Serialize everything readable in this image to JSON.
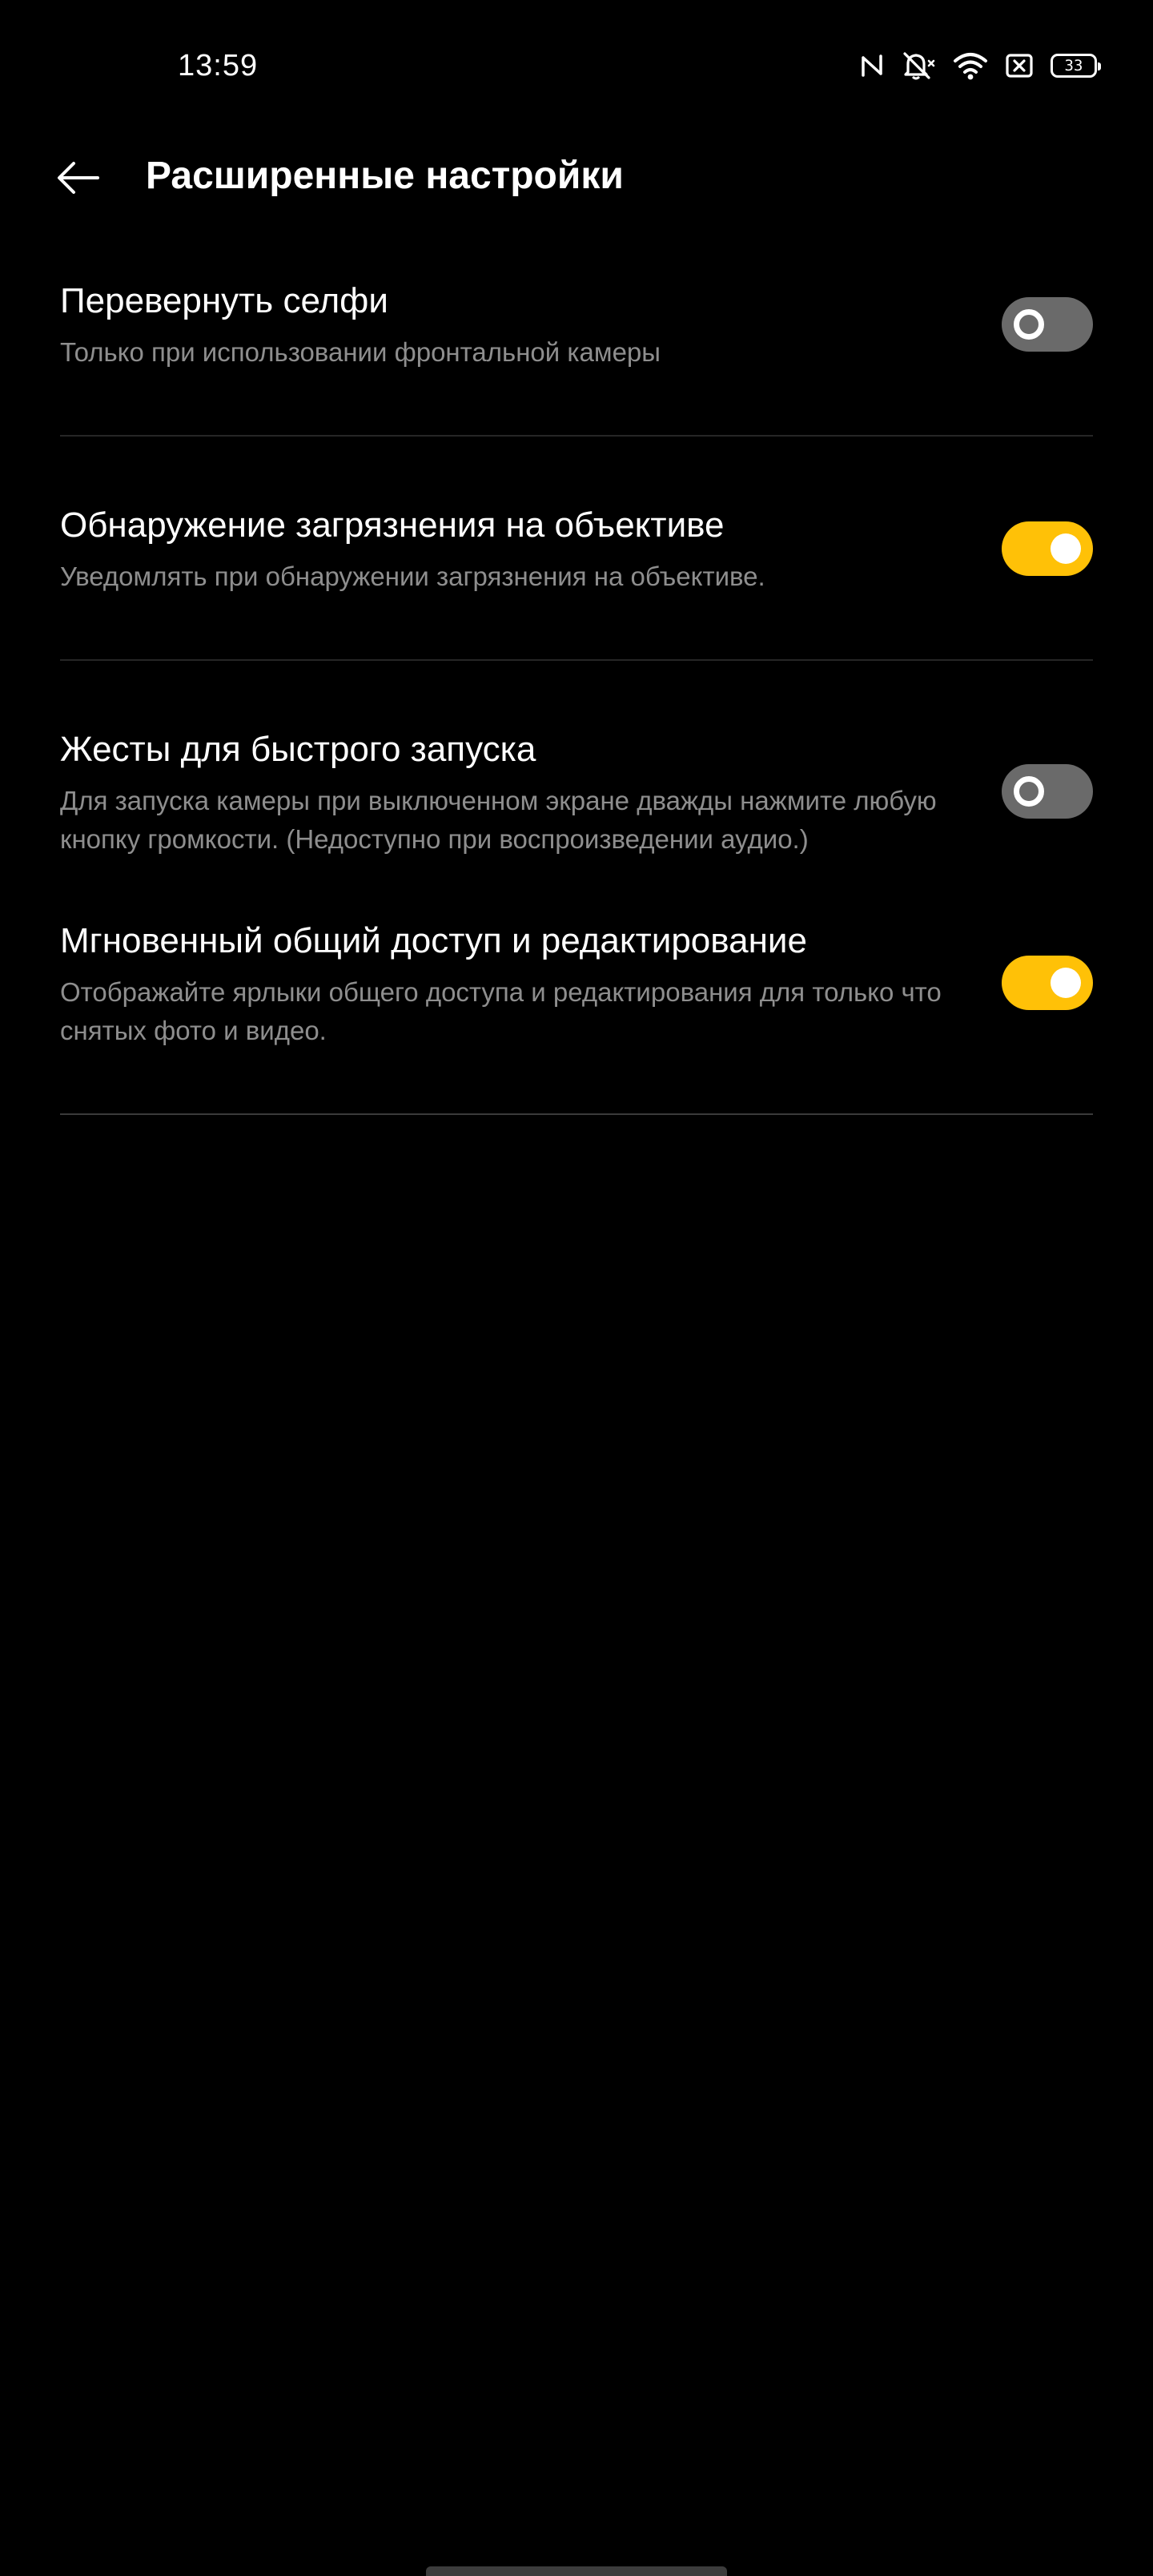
{
  "status_bar": {
    "time": "13:59",
    "battery_level": "33",
    "icons": [
      "nfc-icon",
      "mute-icon",
      "wifi-icon",
      "sim-off-icon",
      "battery-icon"
    ]
  },
  "header": {
    "title": "Расширенные настройки",
    "back_icon": "arrow-left-icon"
  },
  "settings": [
    {
      "title": "Перевернуть селфи",
      "description": "Только при использовании фронтальной камеры",
      "enabled": false
    },
    {
      "title": "Обнаружение загрязнения на объективе",
      "description": "Уведомлять при обнаружении загрязнения на объективе.",
      "enabled": true
    },
    {
      "title": "Жесты для быстрого запуска",
      "description": "Для запуска камеры при выключенном экране дважды нажмите любую кнопку громкости. (Недоступно при воспроизведении аудио.)",
      "enabled": false
    },
    {
      "title": "Мгновенный общий доступ и редактирование",
      "description": "Отображайте ярлыки общего доступа и редактирования для только что снятых фото и видео.",
      "enabled": true
    }
  ],
  "colors": {
    "background": "#000000",
    "accent": "#ffc107",
    "toggle_off": "#6a6a6a",
    "secondary_text": "#8e8e8e"
  }
}
